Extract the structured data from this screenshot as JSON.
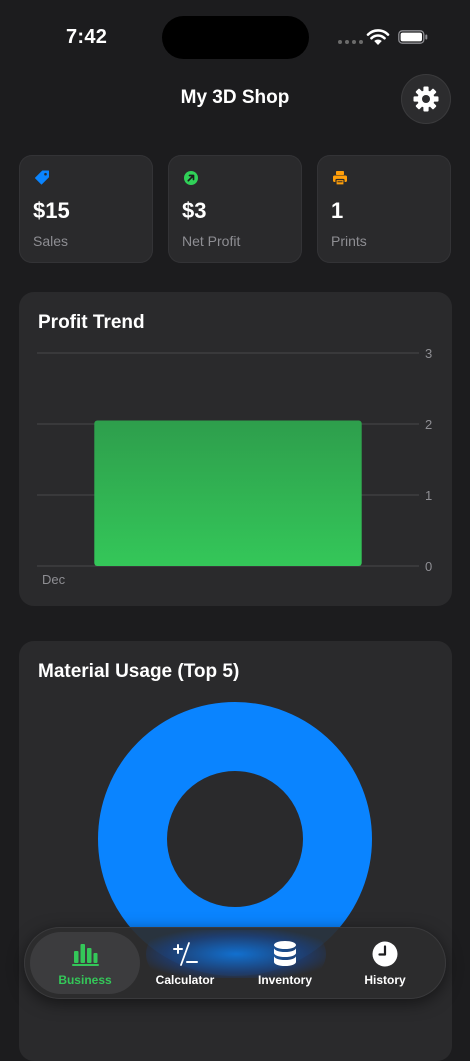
{
  "status": {
    "time": "7:42"
  },
  "header": {
    "title": "My 3D Shop",
    "settings_icon": "gear-icon"
  },
  "stats": [
    {
      "value": "$15",
      "label": "Sales",
      "icon": "tag-icon",
      "color": "#0a84ff"
    },
    {
      "value": "$3",
      "label": "Net Profit",
      "icon": "arrow-up-right-circle-icon",
      "color": "#30d158"
    },
    {
      "value": "1",
      "label": "Prints",
      "icon": "printer-icon",
      "color": "#ff9f0a"
    }
  ],
  "profit_trend": {
    "title": "Profit Trend",
    "chart_data": {
      "type": "bar",
      "categories": [
        "Dec"
      ],
      "values": [
        2.05
      ],
      "ylim": [
        0,
        3
      ],
      "yticks": [
        "0",
        "1",
        "2",
        "3"
      ],
      "y_axis_position": "right",
      "grid": true,
      "color": "#34c759"
    }
  },
  "material_usage": {
    "title": "Material Usage (Top 5)",
    "chart_data": {
      "type": "pie",
      "donut": true,
      "values": [
        1
      ],
      "colors": [
        "#0a84ff"
      ]
    }
  },
  "tabs": [
    {
      "label": "Business",
      "icon": "chart-bar-icon",
      "active": true
    },
    {
      "label": "Calculator",
      "icon": "plus-minus-icon",
      "active": false
    },
    {
      "label": "Inventory",
      "icon": "database-icon",
      "active": false
    },
    {
      "label": "History",
      "icon": "clock-icon",
      "active": false
    }
  ],
  "colors": {
    "accent_green": "#34c759",
    "accent_blue": "#0a84ff",
    "background": "#1c1c1e",
    "card": "#2a2a2c"
  }
}
